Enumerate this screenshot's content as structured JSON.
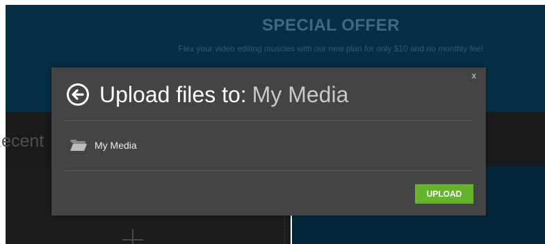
{
  "background": {
    "offer_title": "SPECIAL OFFER",
    "offer_subtitle": "Flex your video editing muscles with our new plan for only $10 and no monthly fee!",
    "recent_label": "Recent E"
  },
  "modal": {
    "close_label": "x",
    "title_prefix": "Upload files to:",
    "title_target": "My Media",
    "folder_label": "My Media",
    "upload_label": "UPLOAD"
  },
  "colors": {
    "banner_bg": "#052f45",
    "modal_bg": "#444444",
    "upload_green": "#66b32e"
  },
  "icons": {
    "back": "circle-arrow-left-icon",
    "folder": "folder-open-icon",
    "plus": "plus-icon"
  }
}
